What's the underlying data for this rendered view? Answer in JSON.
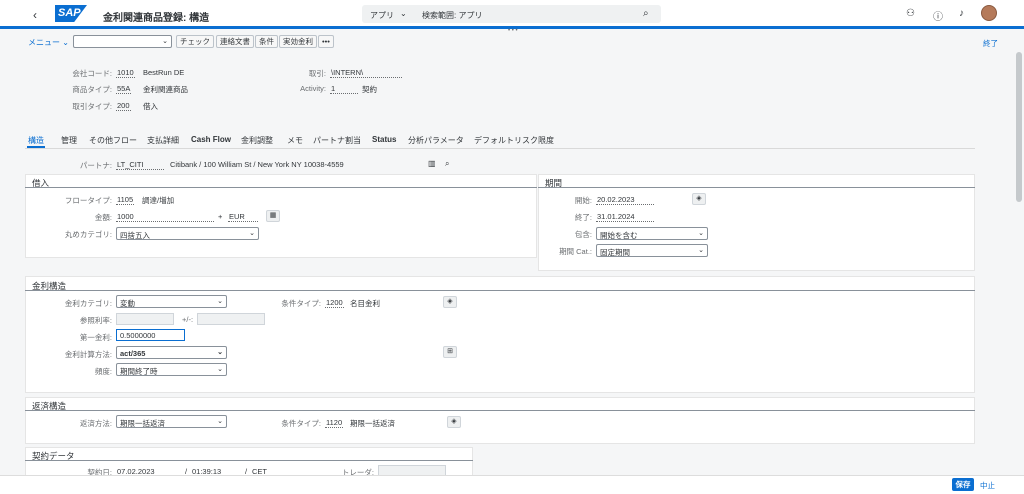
{
  "shell": {
    "back_glyph": "‹",
    "logo": "SAP",
    "title": "金利関連商品登録: 構造",
    "scope": "アプリ",
    "search_placeholder": "検索範囲: アプリ",
    "accent": "#0a6ed1"
  },
  "toolbar": {
    "menu": "メニュー",
    "buttons": [
      "チェック",
      "連絡文書",
      "条件",
      "実効金利"
    ],
    "more": "•••",
    "exit": "終了"
  },
  "header": {
    "company_label": "会社コード:",
    "company_code": "1010",
    "company_name": "BestRun DE",
    "product_label": "商品タイプ:",
    "product_code": "55A",
    "product_name": "金利関連商品",
    "trans_label": "取引タイプ:",
    "trans_code": "200",
    "trans_name": "借入",
    "deal_label": "取引:",
    "deal_value": "\\INTERN\\",
    "activity_label": "Activity:",
    "activity_value": "1",
    "activity_name": "契約"
  },
  "tabs": [
    "構造",
    "管理",
    "その他フロー",
    "支払詳細",
    "Cash Flow",
    "金利調整",
    "メモ",
    "パートナ割当",
    "Status",
    "分析パラメータ",
    "デフォルトリスク限度"
  ],
  "partner": {
    "label": "パートナ:",
    "value": "LT_CITI",
    "desc": "Citibank / 100 William St / New York NY 10038-4559"
  },
  "borrow": {
    "title": "借入",
    "flow_label": "フロータイプ:",
    "flow_code": "1105",
    "flow_name": "調達/増加",
    "amount_label": "金額:",
    "amount": "1000",
    "plus": "+",
    "currency": "EUR",
    "round_label": "丸めカテゴリ:",
    "round_value": "四捨五入"
  },
  "period": {
    "title": "期間",
    "start_label": "開始:",
    "start": "20.02.2023",
    "end_label": "終了:",
    "end": "31.01.2024",
    "incl_label": "包含:",
    "incl": "開始を含む",
    "cat_label": "期間 Cat.:",
    "cat": "固定期間"
  },
  "interest": {
    "title": "金利構造",
    "cat_label": "金利カテゴリ:",
    "cat": "変動",
    "cond_label": "条件タイプ:",
    "cond_code": "1200",
    "cond_name": "名目金利",
    "ref_label": "参照利率:",
    "plusminus": "+/-:",
    "first_label": "第一金利:",
    "first": "0.5000000",
    "method_label": "金利計算方法:",
    "method": "act/365",
    "freq_label": "頻度:",
    "freq": "期間終了時"
  },
  "repay": {
    "title": "返済構造",
    "method_label": "返済方法:",
    "method": "期限一括返済",
    "cond_label": "条件タイプ:",
    "cond_code": "1120",
    "cond_name": "期限一括返済"
  },
  "contract": {
    "title": "契約データ",
    "date_label": "契約日:",
    "date": "07.02.2023",
    "sep": "/",
    "time": "01:39:13",
    "tz": "CET",
    "trader_label": "トレーダ:"
  },
  "footer": {
    "save": "保存",
    "cancel": "中止"
  }
}
